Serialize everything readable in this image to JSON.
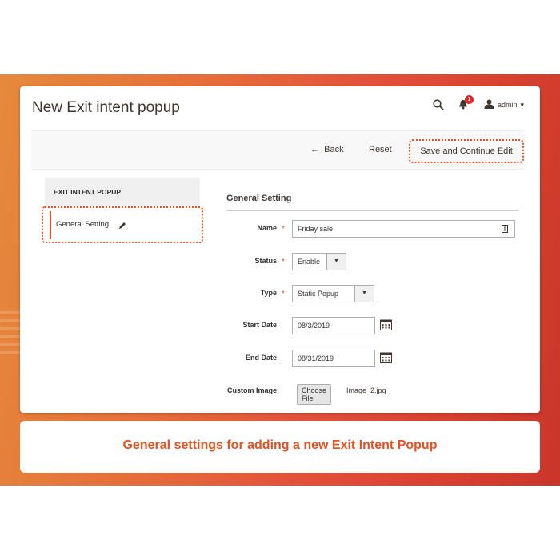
{
  "header": {
    "title": "New Exit intent popup",
    "notification_count": "1",
    "user_label": "admin"
  },
  "toolbar": {
    "back_label": "Back",
    "reset_label": "Reset",
    "save_label": "Save and Continue Edit"
  },
  "sidebar": {
    "heading": "EXIT INTENT POPUP",
    "items": [
      {
        "label": "General Setting"
      }
    ]
  },
  "form": {
    "section_title": "General Setting",
    "name": {
      "label": "Name",
      "value": "Friday sale"
    },
    "status": {
      "label": "Status",
      "value": "Enable"
    },
    "type": {
      "label": "Type",
      "value": "Static Popup"
    },
    "start_date": {
      "label": "Start Date",
      "value": "08/3/2019"
    },
    "end_date": {
      "label": "End Date",
      "value": "08/31/2019"
    },
    "custom_image": {
      "label": "Custom Image",
      "button": "Choose File",
      "filename": "Image_2.jpg"
    }
  },
  "caption": "General settings for adding a new Exit Intent Popup",
  "colors": {
    "accent": "#e8501f",
    "text": "#41362f",
    "badge": "#e22626"
  }
}
